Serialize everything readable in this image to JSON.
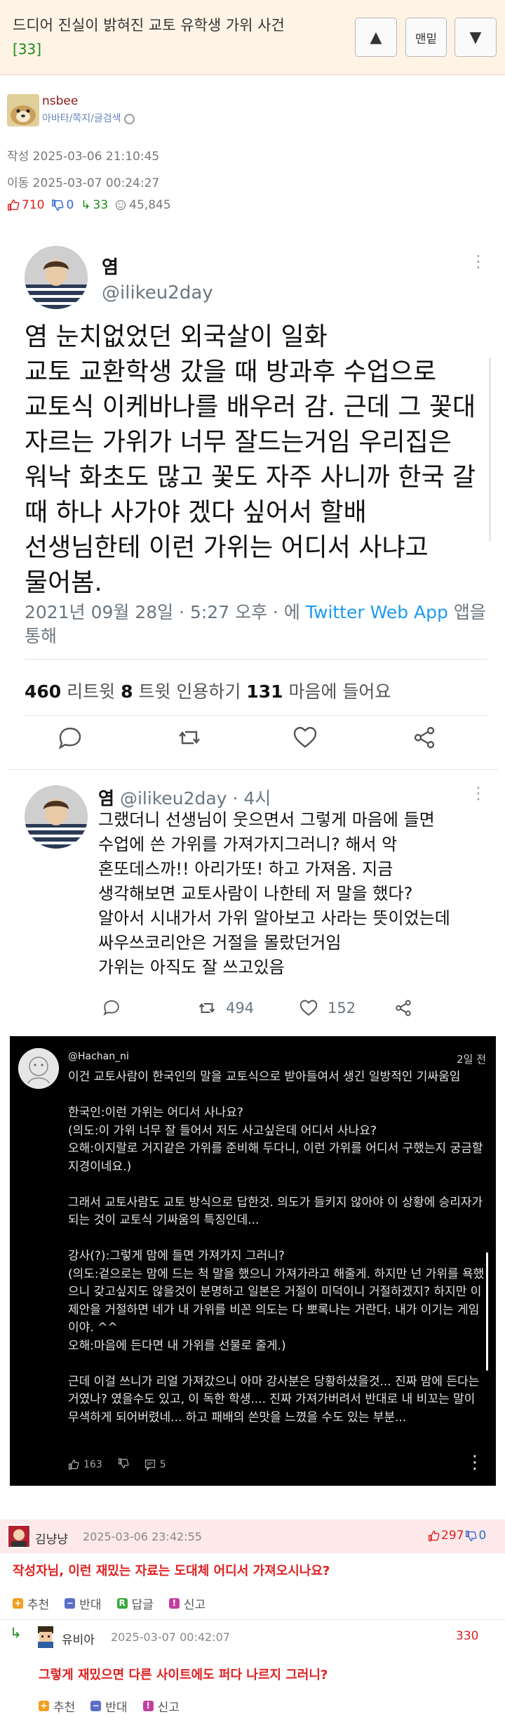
{
  "post": {
    "title": "드디어 진실이 밝혀진 교토 유학생 가위 사건",
    "comment_count": "[33]"
  },
  "nav": {
    "up": "▲",
    "bottom": "맨밑",
    "down": "▼"
  },
  "author": {
    "name": "nsbee",
    "links": "아바타/쪽지/글검색"
  },
  "meta": {
    "created": "작성 2025-03-06 21:10:45",
    "moved": "이동 2025-03-07 00:24:27"
  },
  "stats": {
    "likes": "710",
    "dislikes": "0",
    "shares": "33",
    "views": "45,845"
  },
  "tweet": {
    "name": "염",
    "handle": "@ilikeu2day",
    "body": "염 눈치없었던 외국살이 일화\n교토 교환학생 갔을 때 방과후 수업으로\n교토식 이케바나를 배우러 감. 근데 그 꽃대\n자르는 가위가 너무 잘드는거임 우리집은\n워낙 화초도 많고 꽃도 자주 사니까 한국 갈\n때 하나 사가야 겠다 싶어서 할배\n선생님한테 이런 가위는 어디서 사냐고\n물어봄.",
    "time": "2021년 09월 28일 · 5:27 오후 · 에 ",
    "app": "Twitter Web App",
    "app_suffix": " 앱을 통해",
    "retweets": "460",
    "retweets_label": " 리트윗  ",
    "quotes": "8",
    "quotes_label": " 트윗 인용하기  ",
    "likes": "131",
    "likes_label": " 마음에 들어요"
  },
  "reply": {
    "name": "염",
    "handle": " @ilikeu2day · 4시",
    "body": "그랬더니 선생님이 웃으면서 그렇게 마음에 들면\n수업에 쓴 가위를 가져가지그러니? 해서 악\n혼또데스까!! 아리가또! 하고 가져옴. 지금\n생각해보면 교토사람이 나한테 저 말을 했다?\n알아서 시내가서 가위 알아보고 사라는 뜻이었는데\n싸우쓰코리안은 거절을 몰랐던거임\n가위는 아직도 잘 쓰고있음",
    "retweets": "494",
    "likes": "152"
  },
  "dark": {
    "handle": "@Hachan_ni",
    "date": "2일 전",
    "body": "이건 교토사람이 한국인의 말을 교토식으로 받아들여서 생긴 일방적인 기싸움임\n\n한국인:이런 가위는 어디서 사나요?\n(의도:이 가위 너무 잘 들어서 저도 사고싶은데 어디서 사나요?\n오해:이지랄로 거지같은 가위를 준비해 두다니, 이런 가위를 어디서 구했는지 궁금할 지경이네요.)\n\n그래서 교토사람도 교토 방식으로 답한것. 의도가 들키지 않아야 이 상황에 승리자가 되는 것이 교토식 기싸움의 특징인데...\n\n강사(?):그렇게 맘에 들면 가져가지 그러니?\n(의도:겉으로는 맘에 드는 척 말을 했으니 가져가라고 해줄게. 하지만 넌 가위를 욕했으니 갖고싶지도 않을것이 분명하고 일본은 거절이 미덕이니 거절하겠지? 하지만 이 제안을 거절하면 네가 내 가위를 비꼰 의도는 다 뽀록나는 거란다. 내가 이기는 게임이야. ^^\n오해:마음에 든다면 내 가위를 선물로 줄게.)\n\n근데 이걸 쓰니가 리얼 가져갔으니 아마 강사분은 당황하셨을것... 진짜 맘에 든다는 거였나? 였을수도 있고, 이 독한 학생.... 진짜 가져가버려서 반대로 내 비꼬는 말이 무색하게 되어버렸네... 하고 패배의 쓴맛을 느꼈을 수도 있는 부분...",
    "likes": "163",
    "comments": "5"
  },
  "comments": [
    {
      "name": "김냥냥",
      "date": "2025-03-06 23:42:55",
      "likes": "297",
      "dislikes": "0",
      "text": "작성자님, 이런 재밌는 자료는 도대체 어디서 가져오시나요?",
      "buttons": [
        "추천",
        "반대",
        "답글",
        "신고"
      ]
    },
    {
      "name": "유비아",
      "date": "2025-03-07 00:42:07",
      "score": "330",
      "text": "그렇게 재밌으면 다른 사이트에도 퍼다 나르지 그러니?",
      "buttons": [
        "추천",
        "반대",
        "신고"
      ]
    }
  ],
  "colors": {
    "accent_red": "#e02020",
    "green": "#1a8a1a",
    "blue": "#3366cc",
    "twitter_blue": "#1d9bf0"
  }
}
